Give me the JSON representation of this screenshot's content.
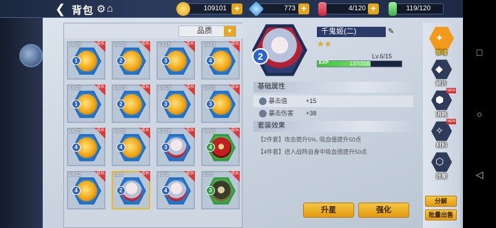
{
  "header": {
    "title": "背包",
    "resources": [
      {
        "name": "gold",
        "value": "109101",
        "color": "#f2b51e"
      },
      {
        "name": "diamond",
        "value": "773",
        "color": "#4fb4f0"
      },
      {
        "name": "stamina",
        "value": "4/120",
        "color": "#e04a5b"
      },
      {
        "name": "energy",
        "value": "119/120",
        "color": "#62d46a"
      }
    ]
  },
  "bag": {
    "sort_label": "品质",
    "items": [
      {
        "lv": "Lv.15",
        "num": "1",
        "art": "dragon",
        "badge": "成长"
      },
      {
        "lv": "Lv.15",
        "num": "2",
        "art": "dragon",
        "badge": "成长"
      },
      {
        "lv": "Lv.15",
        "num": "3",
        "art": "dragon",
        "badge": "成长"
      },
      {
        "lv": "Lv.15",
        "num": "4",
        "art": "dragon",
        "badge": "成长"
      },
      {
        "lv": "Lv.15",
        "num": "1",
        "art": "dragon",
        "badge": "成长"
      },
      {
        "lv": "Lv.15",
        "num": "2",
        "art": "dragon",
        "badge": "成长"
      },
      {
        "lv": "Lv.15",
        "num": "3",
        "art": "dragon",
        "badge": "成长"
      },
      {
        "lv": "Lv.15",
        "num": "3",
        "art": "dragon",
        "badge": "成长"
      },
      {
        "lv": "Lv.15",
        "num": "4",
        "art": "dragon",
        "badge": "成长"
      },
      {
        "lv": "Lv.15",
        "num": "4",
        "art": "dragon",
        "badge": "成长"
      },
      {
        "lv": "Lv.15",
        "num": "3",
        "art": "girl",
        "badge": "成长"
      },
      {
        "lv": "Lv.15",
        "num": "4",
        "art": "oni",
        "badge": "成长",
        "green": true
      },
      {
        "lv": "Lv.12",
        "num": "4",
        "art": "dragon",
        "badge": "成长"
      },
      {
        "lv": "Lv.6",
        "num": "2",
        "art": "girl",
        "badge": "成长",
        "selected": true
      },
      {
        "lv": "Lv.5",
        "num": "4",
        "art": "girl",
        "badge": "成长"
      },
      {
        "lv": "Lv.5",
        "num": "3",
        "art": "ninja",
        "badge": "成长",
        "green": true
      }
    ]
  },
  "detail": {
    "slot_num": "2",
    "name": "千鬼姬(二)",
    "stars_on": "★",
    "stars_off": "★",
    "level": "Lv.6/15",
    "exp_label": "EXP",
    "exp_text": "137/216",
    "exp_ratio": 0.634,
    "basic_title": "基础属性",
    "stats": [
      {
        "name": "暴击值",
        "value": "+15"
      },
      {
        "name": "暴击伤害",
        "value": "+38"
      }
    ],
    "set_title": "套装效果",
    "set_lines": [
      "【2件套】攻击提升5%, 吸血值提升50点",
      "【4件套】进入战阵自身中吸血值提升50点"
    ],
    "btn_upstar": "升星",
    "btn_enhance": "强化"
  },
  "tabs": {
    "items": [
      {
        "label": "御魂",
        "active": true,
        "new": false
      },
      {
        "label": "碎片",
        "active": false,
        "new": false
      },
      {
        "label": "消耗",
        "active": false,
        "new": true
      },
      {
        "label": "材料",
        "active": false,
        "new": true
      },
      {
        "label": "技能",
        "active": false,
        "new": false
      }
    ],
    "new_badge": "NEW",
    "btn_split": "分解",
    "btn_bulk_sell": "批量出售"
  }
}
